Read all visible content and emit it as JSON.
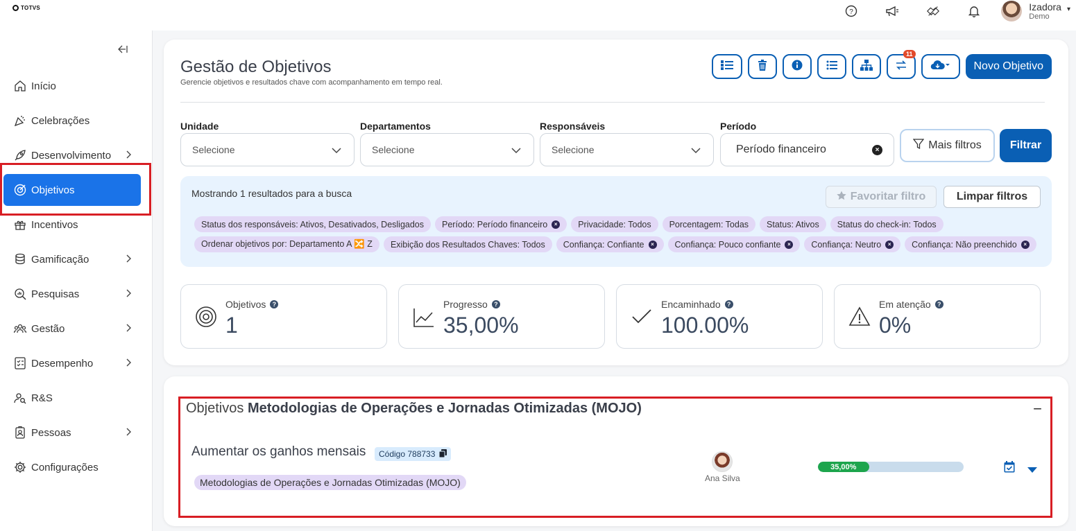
{
  "brand": {
    "logo_text": "TOTVS"
  },
  "topbar": {
    "icons": [
      "help-icon",
      "megaphone-icon",
      "handshake-icon",
      "bell-icon"
    ],
    "user": {
      "name": "Izadora",
      "role": "Demo"
    }
  },
  "sidebar": {
    "collapse_icon": "collapse-left-icon",
    "items": [
      {
        "label": "Início",
        "icon": "home-icon",
        "has_submenu": false,
        "active": false
      },
      {
        "label": "Celebrações",
        "icon": "party-icon",
        "has_submenu": false,
        "active": false
      },
      {
        "label": "Desenvolvimento",
        "icon": "rocket-icon",
        "has_submenu": true,
        "active": false
      },
      {
        "label": "Objetivos",
        "icon": "target-icon",
        "has_submenu": false,
        "active": true
      },
      {
        "label": "Incentivos",
        "icon": "incentive-icon",
        "has_submenu": false,
        "active": false
      },
      {
        "label": "Gamificação",
        "icon": "coins-icon",
        "has_submenu": true,
        "active": false
      },
      {
        "label": "Pesquisas",
        "icon": "survey-icon",
        "has_submenu": true,
        "active": false
      },
      {
        "label": "Gestão",
        "icon": "team-icon",
        "has_submenu": true,
        "active": false
      },
      {
        "label": "Desempenho",
        "icon": "checklist-icon",
        "has_submenu": true,
        "active": false
      },
      {
        "label": "R&S",
        "icon": "recruit-icon",
        "has_submenu": false,
        "active": false
      },
      {
        "label": "Pessoas",
        "icon": "badge-icon",
        "has_submenu": true,
        "active": false
      },
      {
        "label": "Configurações",
        "icon": "gear-icon",
        "has_submenu": false,
        "active": false
      }
    ]
  },
  "header": {
    "title": "Gestão de Objetivos",
    "subtitle": "Gerencie objetivos e resultados chave com acompanhamento em tempo real.",
    "toolbar_icons": [
      "list-view-icon",
      "trash-icon",
      "info-icon",
      "list-icon",
      "hierarchy-icon",
      "sync-icon",
      "cloud-download-icon"
    ],
    "sync_badge": "11",
    "new_button": "Novo Objetivo"
  },
  "filters": {
    "unidade": {
      "label": "Unidade",
      "value": "Selecione"
    },
    "departamentos": {
      "label": "Departamentos",
      "value": "Selecione"
    },
    "responsaveis": {
      "label": "Responsáveis",
      "value": "Selecione"
    },
    "periodo": {
      "label": "Período",
      "value": "Período financeiro"
    },
    "more_filters": "Mais filtros",
    "apply": "Filtrar"
  },
  "results": {
    "text": "Mostrando 1 resultados para a busca",
    "favorite": "Favoritar filtro",
    "clear": "Limpar filtros",
    "chips": [
      {
        "label": "Status dos responsáveis: Ativos, Desativados, Desligados",
        "removable": false
      },
      {
        "label": "Período: Período financeiro",
        "removable": true
      },
      {
        "label": "Privacidade: Todos",
        "removable": false
      },
      {
        "label": "Porcentagem: Todas",
        "removable": false
      },
      {
        "label": "Status: Ativos",
        "removable": false
      },
      {
        "label": "Status do check-in: Todos",
        "removable": false
      },
      {
        "label": "Ordenar objetivos por: Departamento A 🔀 Z",
        "removable": false
      },
      {
        "label": "Exibição dos Resultados Chaves: Todos",
        "removable": false
      },
      {
        "label": "Confiança: Confiante",
        "removable": true
      },
      {
        "label": "Confiança: Pouco confiante",
        "removable": true
      },
      {
        "label": "Confiança: Neutro",
        "removable": true
      },
      {
        "label": "Confiança: Não preenchido",
        "removable": true
      }
    ]
  },
  "stats": [
    {
      "label": "Objetivos",
      "value": "1",
      "icon": "target-icon"
    },
    {
      "label": "Progresso",
      "value": "35,00%",
      "icon": "trend-chart-icon"
    },
    {
      "label": "Encaminhado",
      "value": "100.00%",
      "icon": "check-icon"
    },
    {
      "label": "Em atenção",
      "value": "0%",
      "icon": "warning-icon"
    }
  ],
  "objectives_group": {
    "prefix": "Objetivos",
    "name": "Metodologias de Operações e Jornadas Otimizadas (MOJO)",
    "items": [
      {
        "title": "Aumentar os ganhos mensais",
        "code": "Código 788733",
        "department": "Metodologias de Operações e Jornadas Otimizadas (MOJO)",
        "owner": "Ana Silva",
        "progress_label": "35,00%",
        "progress_value": 0.35
      }
    ]
  },
  "colors": {
    "primary": "#0a5fb4",
    "active_nav": "#1a73e8",
    "highlight_box": "#d81e24",
    "chip_bg": "#e2d8f6",
    "progress_fill": "#1da54d"
  }
}
